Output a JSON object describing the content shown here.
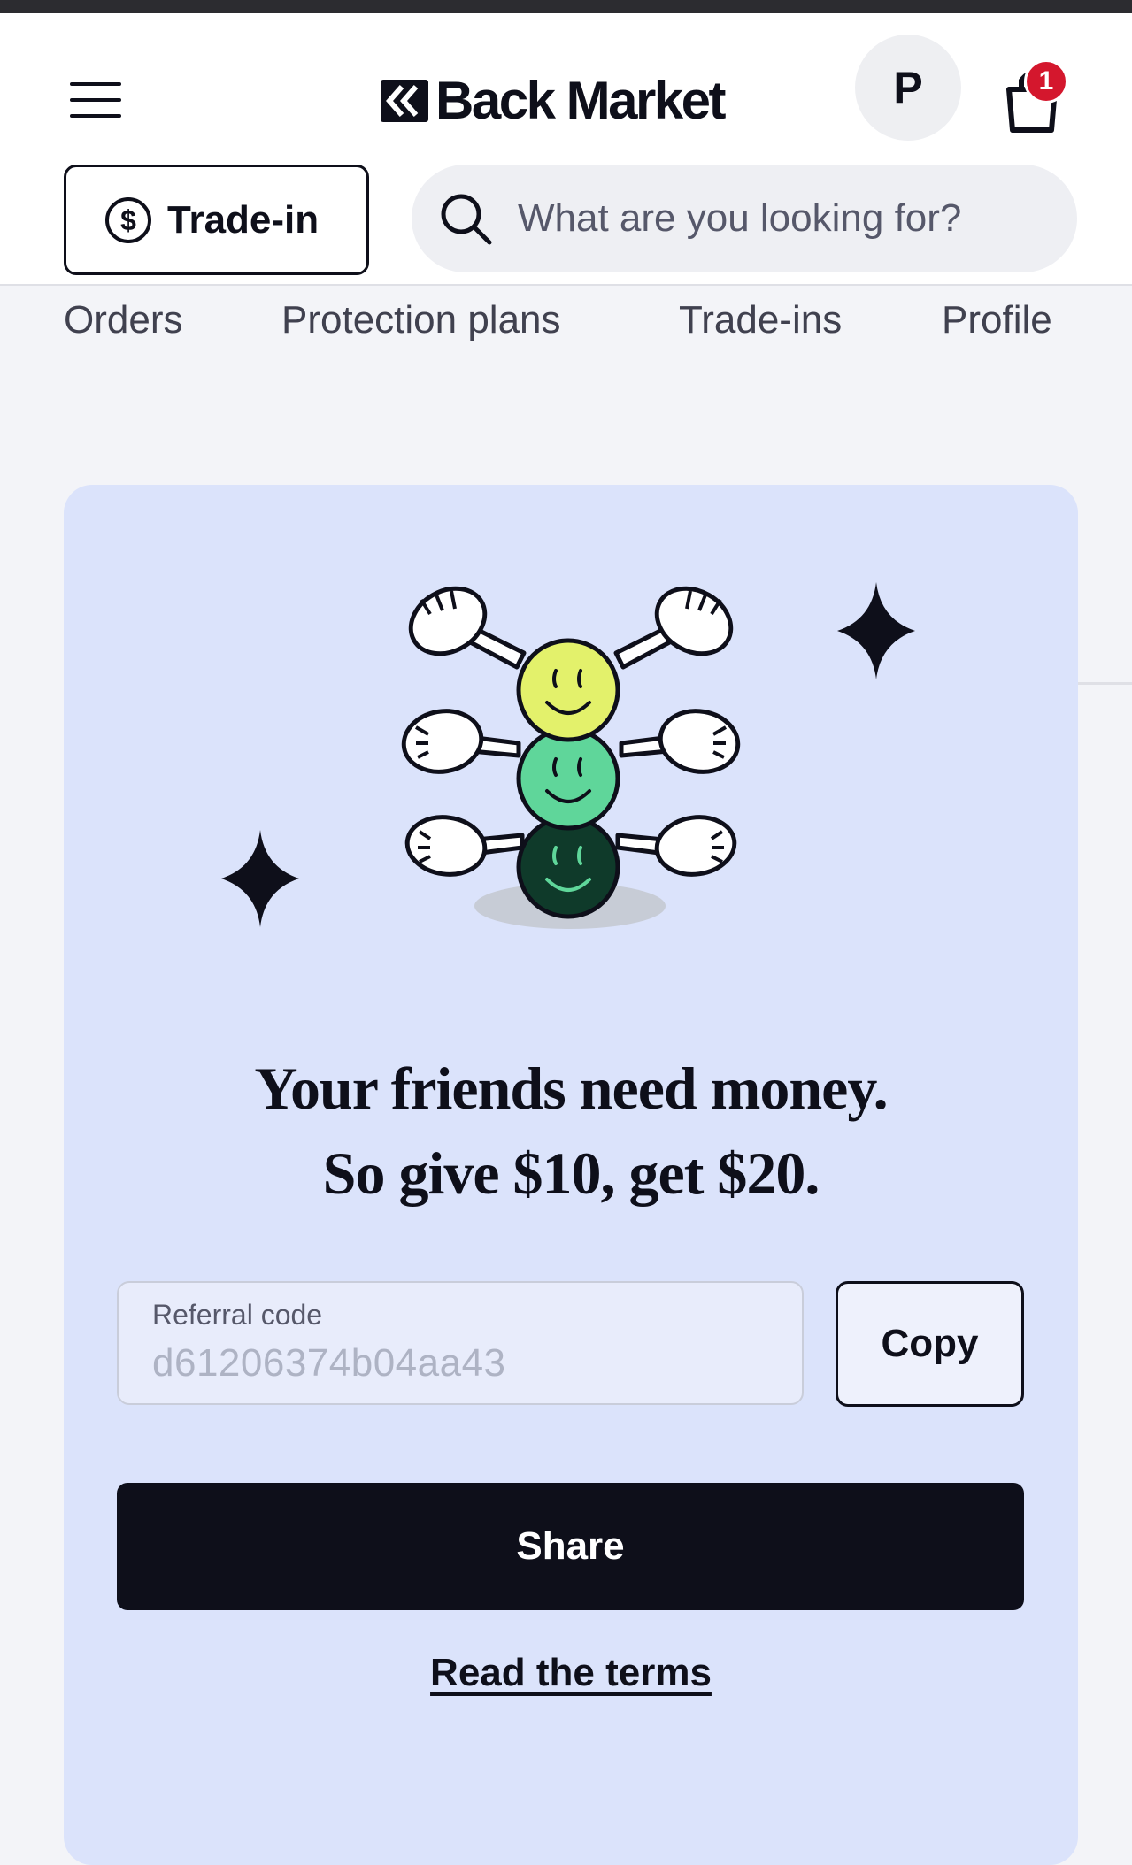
{
  "header": {
    "brand": "Back Market",
    "avatar_initial": "P",
    "cart_count": "1",
    "tradein_label": "Trade-in",
    "search_placeholder": "What are you looking for?",
    "icons": [
      "menu-icon",
      "back-market-logo-icon",
      "shopping-bag-icon",
      "dollar-circle-icon",
      "search-icon"
    ]
  },
  "tabs": [
    "Orders",
    "Protection plans",
    "Trade-ins",
    "Profile"
  ],
  "referral": {
    "headline_line1": "Your friends need money.",
    "headline_line2": "So give $10, get $20.",
    "code_label": "Referral code",
    "code_value": "d61206374b04aa43",
    "copy_label": "Copy",
    "share_label": "Share",
    "terms_label": "Read the terms"
  },
  "colors": {
    "card_background": "#dbe3fb",
    "badge": "#d4172d",
    "primary": "#0e0f1a",
    "smiley_yellow": "#e3f16b",
    "smiley_green": "#5fd69a",
    "smiley_dark": "#0f3a2a"
  }
}
